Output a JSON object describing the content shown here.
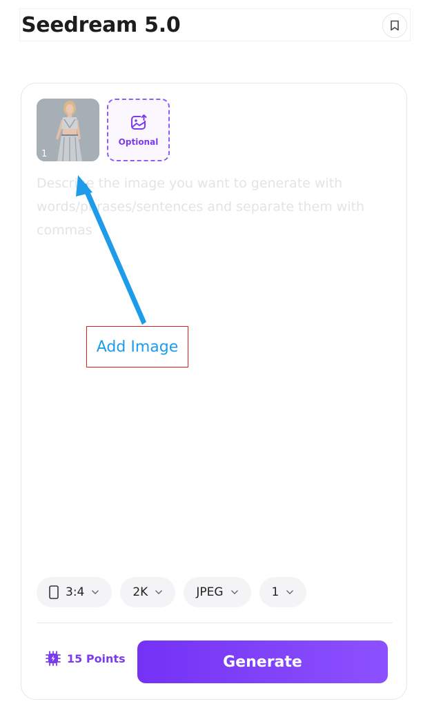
{
  "header": {
    "title": "Seedream 5.0",
    "bookmark_icon": "bookmark-icon"
  },
  "uploads": [
    {
      "index_label": "1",
      "type": "image"
    }
  ],
  "optional_upload": {
    "label": "Optional",
    "icon": "image-upload-icon"
  },
  "prompt": {
    "placeholder": "Describe the image you want to generate with words/phrases/sentences and separate them with commas",
    "value": ""
  },
  "annotation": {
    "label": "Add Image",
    "color": "#1e9be9",
    "border_color": "#e11d1d"
  },
  "options": {
    "aspect_ratio": "3:4",
    "resolution": "2K",
    "format": "JPEG",
    "count": "1"
  },
  "footer": {
    "points_label": "15 Points",
    "generate_label": "Generate"
  },
  "colors": {
    "accent": "#7c3aed",
    "button_gradient_start": "#7432f5",
    "button_gradient_end": "#8c51ff"
  }
}
